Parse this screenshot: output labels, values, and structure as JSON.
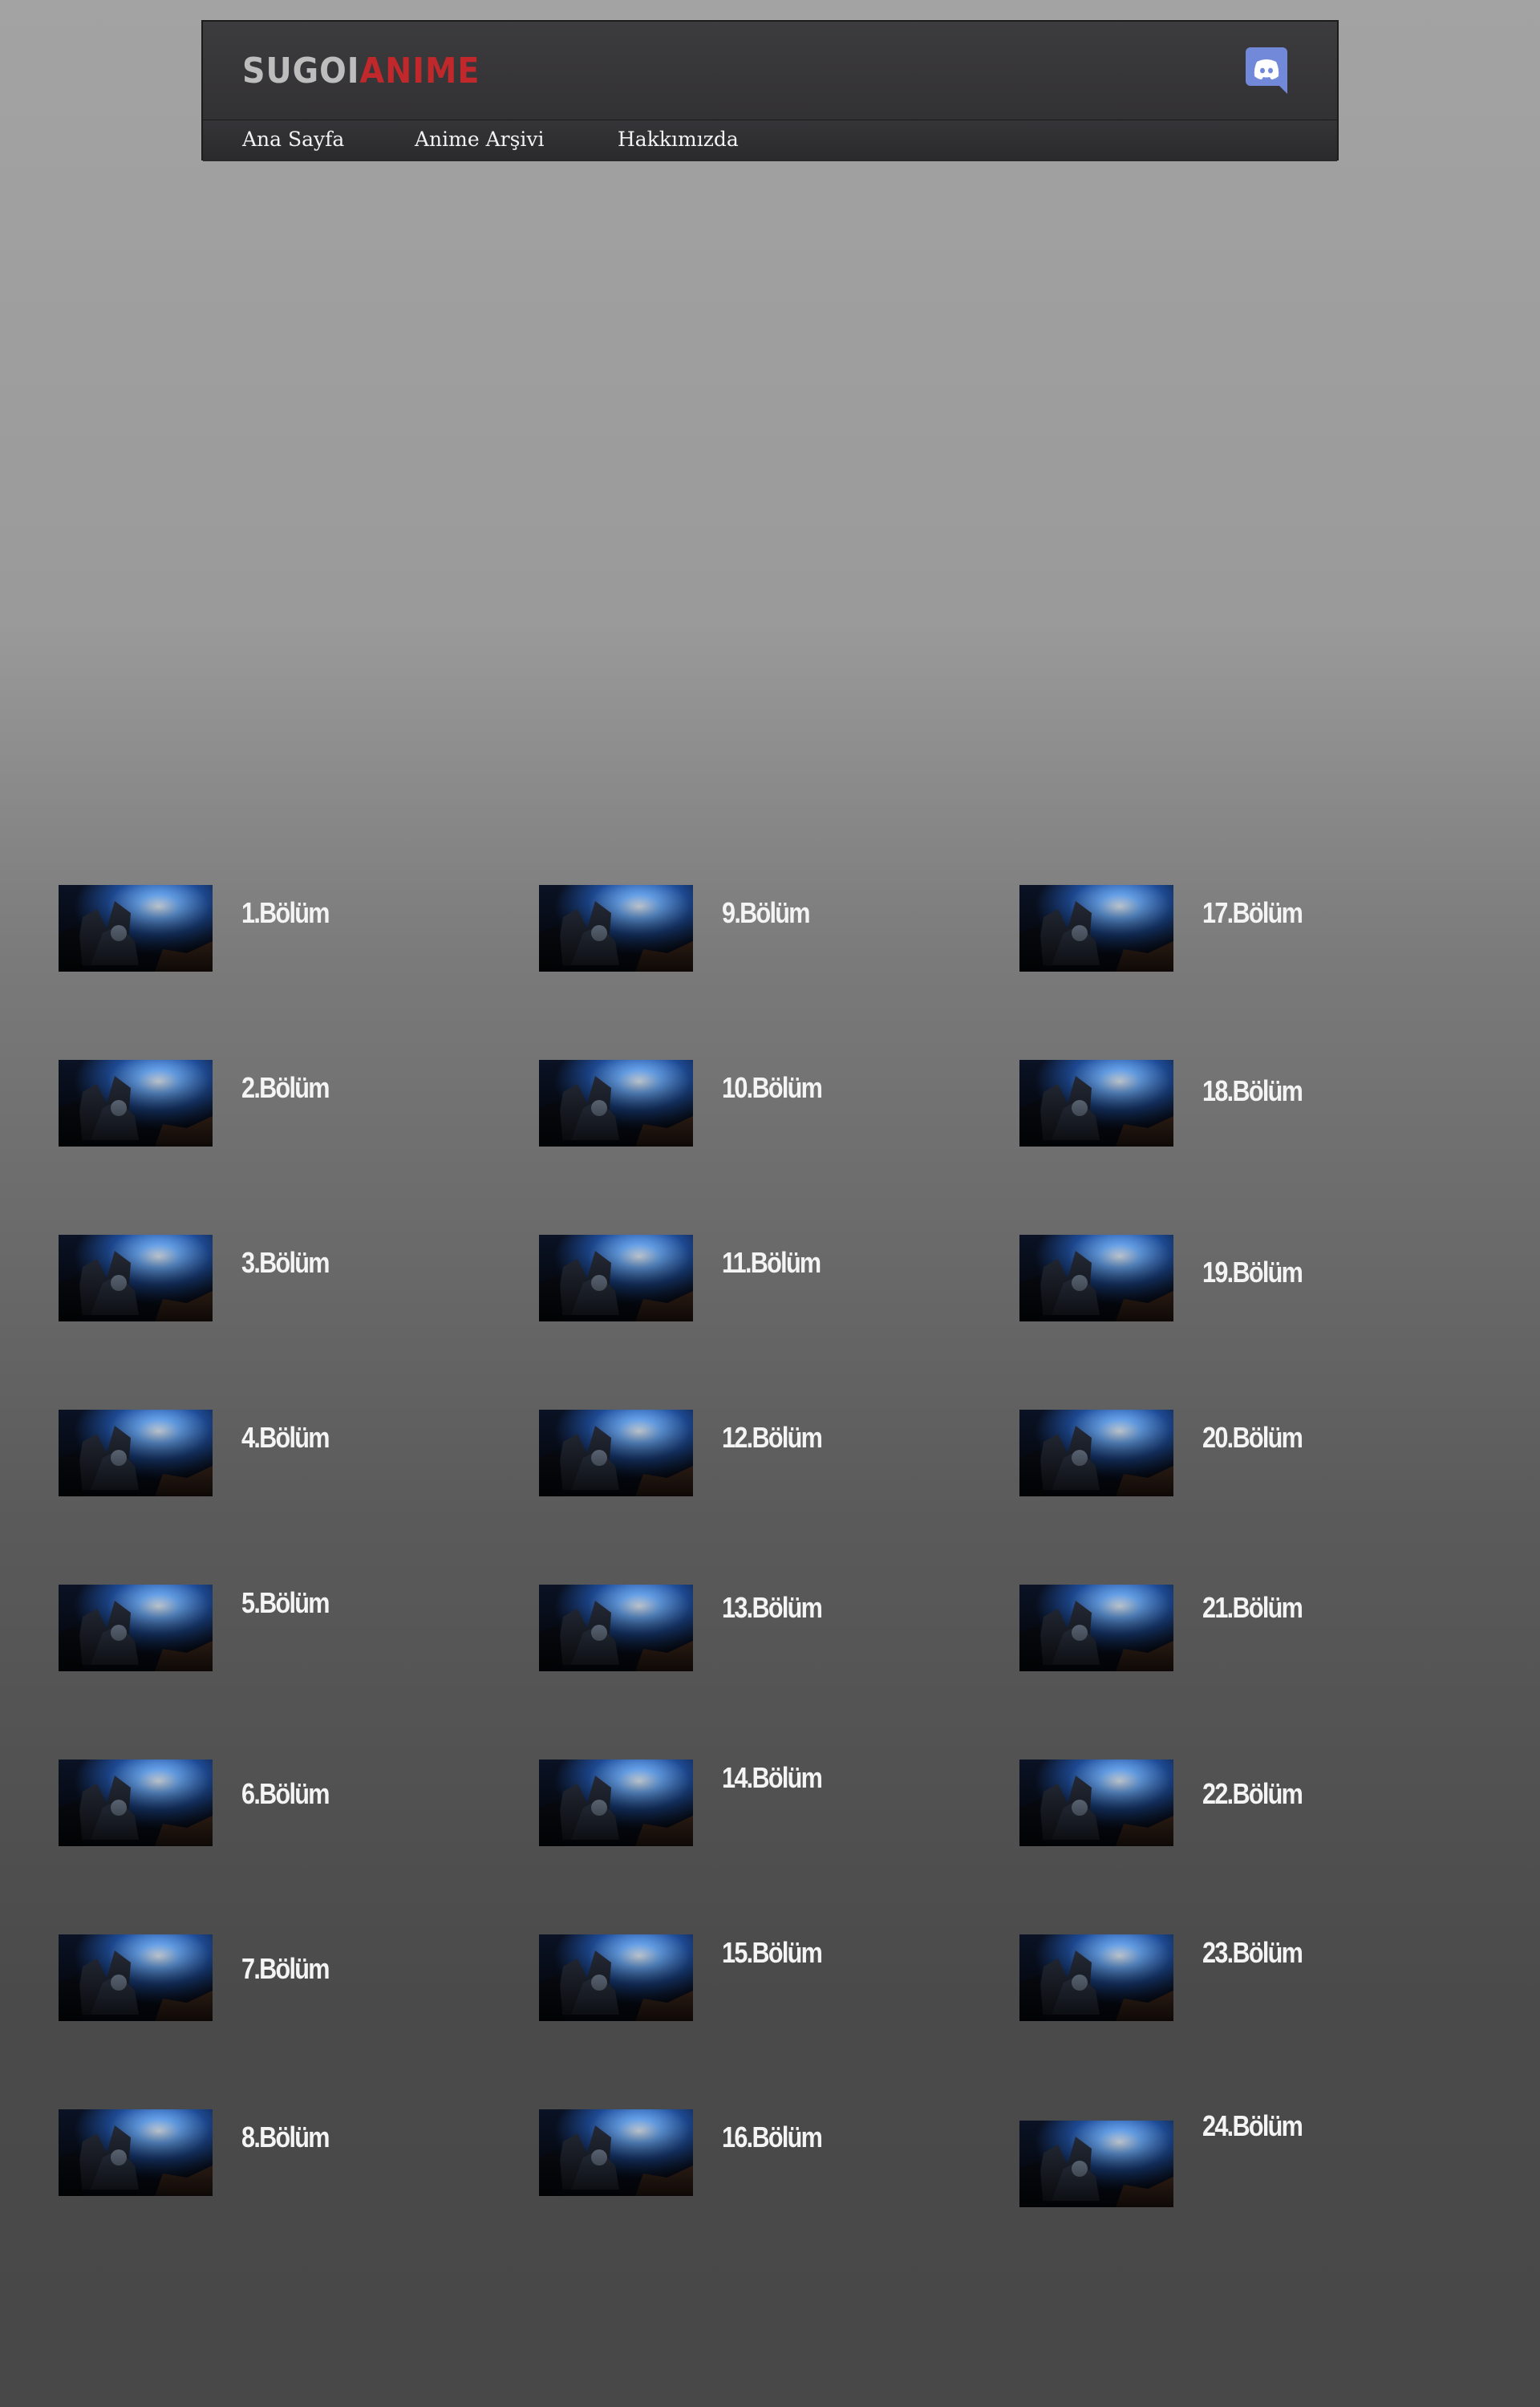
{
  "site": {
    "logo_part1": "SUGOI",
    "logo_part2": "ANIME",
    "accent_color": "#c0282b",
    "discord_icon": "discord-icon",
    "discord_color": "#7289da"
  },
  "nav": {
    "items": [
      {
        "label": "Ana Sayfa"
      },
      {
        "label": "Anime Arşivi"
      },
      {
        "label": "Hakkımızda"
      }
    ]
  },
  "episodes": {
    "columns": [
      [
        "1.Bölüm",
        "2.Bölüm",
        "3.Bölüm",
        "4.Bölüm",
        "5.Bölüm",
        "6.Bölüm",
        "7.Bölüm",
        "8.Bölüm"
      ],
      [
        "9.Bölüm",
        "10.Bölüm",
        "11.Bölüm",
        "12.Bölüm",
        "13.Bölüm",
        "14.Bölüm",
        "15.Bölüm",
        "16.Bölüm"
      ],
      [
        "17.Bölüm",
        "18.Bölüm",
        "19.Bölüm",
        "20.Bölüm",
        "21.Bölüm",
        "22.Bölüm",
        "23.Bölüm",
        "24.Bölüm"
      ]
    ],
    "thumbnail_icon": "episode-thumbnail"
  }
}
